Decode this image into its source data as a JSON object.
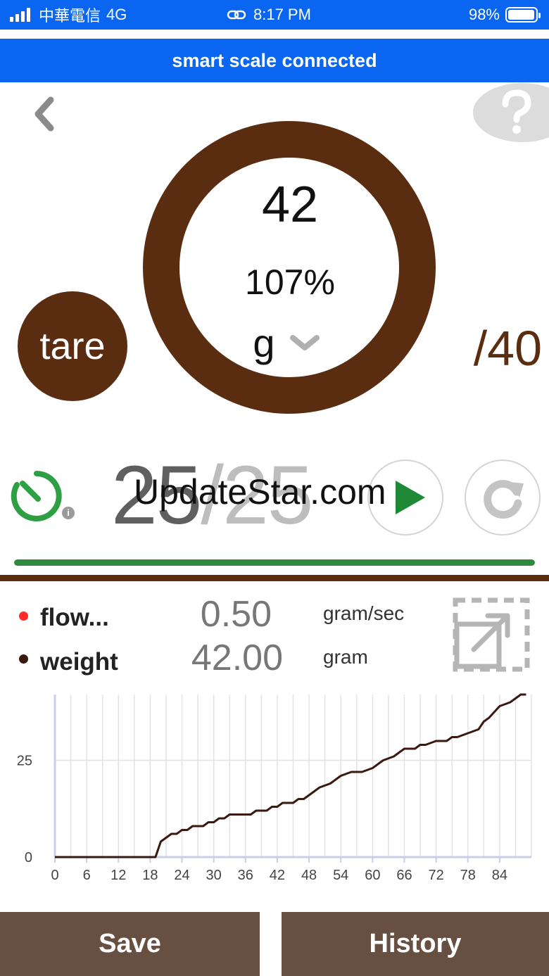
{
  "status_bar": {
    "carrier": "中華電信",
    "network": "4G",
    "time": "8:17 PM",
    "battery": "98%",
    "battery_level": 0.98
  },
  "banner": {
    "text": "smart scale connected"
  },
  "scale": {
    "weight": "42",
    "percent": "107%",
    "unit": "g",
    "target": "/40",
    "tare_label": "tare",
    "ring_color": "#5a2d10"
  },
  "timer": {
    "current": "25",
    "separator": "/",
    "total": "25",
    "progress": 1.0,
    "info_label": "i"
  },
  "watermark": "UpdateStar.com",
  "legend": [
    {
      "label": "flow...",
      "value": "0.50",
      "unit": "gram/sec",
      "color": "#ff2a2a"
    },
    {
      "label": "weight",
      "value": "42.00",
      "unit": "gram",
      "color": "#3a1a10"
    }
  ],
  "chart_data": {
    "type": "line",
    "xlim": [
      0,
      90
    ],
    "ylim": [
      0,
      42
    ],
    "x_ticks": [
      0,
      6,
      12,
      18,
      24,
      30,
      36,
      42,
      48,
      54,
      60,
      66,
      72,
      78,
      84
    ],
    "y_ticks": [
      0,
      25
    ],
    "grid": true,
    "series": [
      {
        "color": "#3a1a10",
        "x": [
          0,
          19,
          20,
          21,
          22,
          23,
          24,
          25,
          26,
          27,
          28,
          29,
          30,
          31,
          32,
          33,
          34,
          35,
          36,
          37,
          38,
          39,
          40,
          41,
          42,
          43,
          44,
          45,
          46,
          47,
          48,
          50,
          52,
          54,
          56,
          58,
          60,
          62,
          64,
          65,
          66,
          68,
          69,
          70,
          72,
          74,
          75,
          76,
          78,
          80,
          81,
          82,
          84,
          86,
          88,
          89
        ],
        "y": [
          0,
          0,
          4,
          5,
          6,
          6,
          7,
          7,
          8,
          8,
          8,
          9,
          9,
          10,
          10,
          11,
          11,
          11,
          11,
          11,
          12,
          12,
          12,
          13,
          13,
          14,
          14,
          14,
          15,
          15,
          16,
          18,
          19,
          21,
          22,
          22,
          23,
          25,
          26,
          27,
          28,
          28,
          29,
          29,
          30,
          30,
          31,
          31,
          32,
          33,
          35,
          36,
          39,
          40,
          42,
          42
        ]
      }
    ]
  },
  "buttons": {
    "save": "Save",
    "history": "History"
  }
}
